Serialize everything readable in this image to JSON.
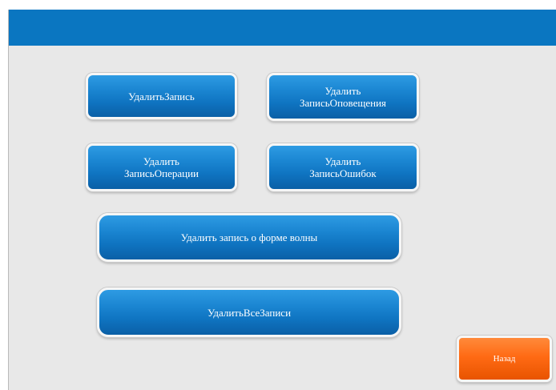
{
  "buttons": {
    "delete_record": "УдалитьЗапись",
    "delete_alert_record": "Удалить\nЗаписьОповещения",
    "delete_operation_record": "Удалить\nЗаписьОперации",
    "delete_error_record": "Удалить\nЗаписьОшибок",
    "delete_waveform_record": "Удалить запись о форме волны",
    "delete_all_records": "УдалитьВсеЗаписи",
    "back": "Назад"
  },
  "colors": {
    "header": "#0a76c1",
    "primary_button": "#1b86d2",
    "back_button": "#ff6a14",
    "background": "#e8e8e8"
  }
}
